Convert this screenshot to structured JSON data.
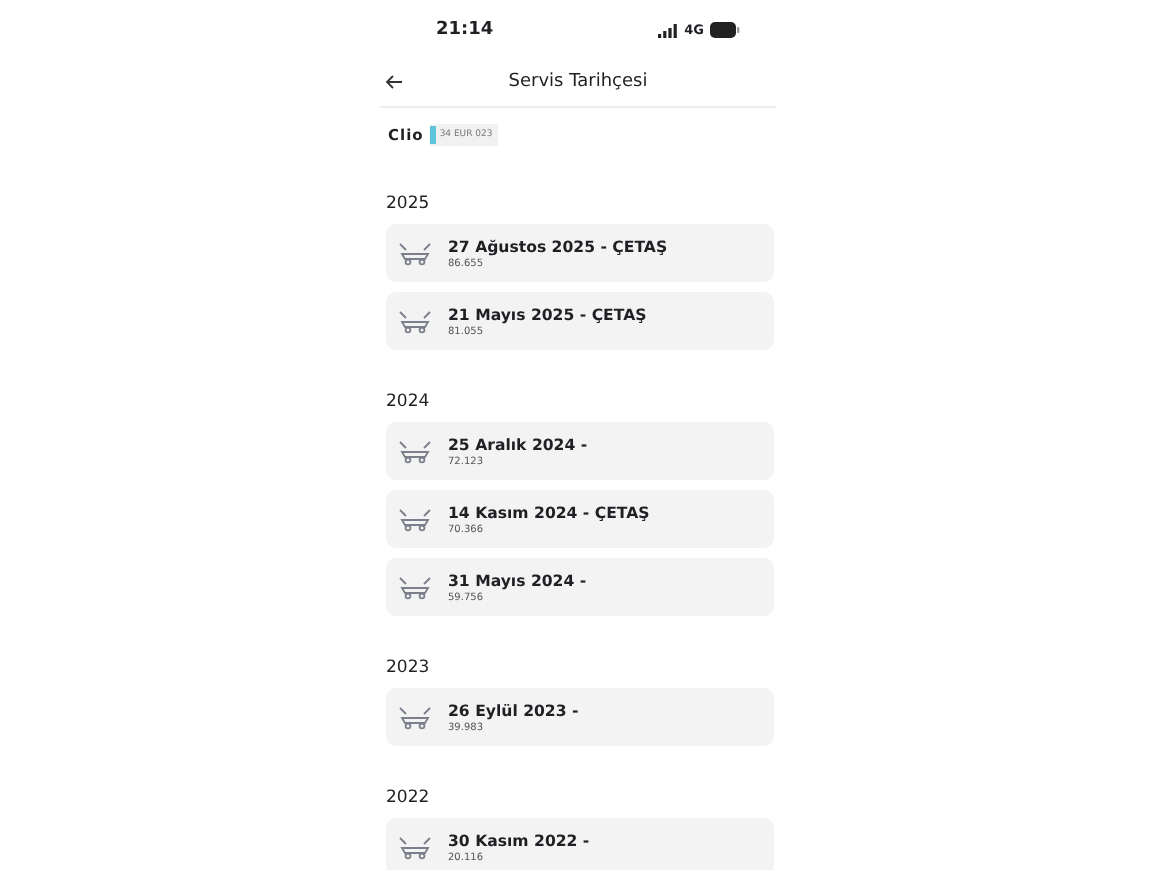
{
  "status_bar": {
    "time": "21:14",
    "network": "4G"
  },
  "header": {
    "title": "Servis Tarihçesi"
  },
  "vehicle": {
    "model": "Clio",
    "plate": "34 EUR 023"
  },
  "groups": [
    {
      "year": "2025",
      "records": [
        {
          "title": "27 Ağustos 2025 - ÇETAŞ",
          "mileage": "86.655"
        },
        {
          "title": "21 Mayıs 2025 - ÇETAŞ",
          "mileage": "81.055"
        }
      ]
    },
    {
      "year": "2024",
      "records": [
        {
          "title": "25 Aralık 2024 -",
          "mileage": "72.123"
        },
        {
          "title": "14 Kasım 2024 - ÇETAŞ",
          "mileage": "70.366"
        },
        {
          "title": "31 Mayıs 2024 -",
          "mileage": "59.756"
        }
      ]
    },
    {
      "year": "2023",
      "records": [
        {
          "title": "26 Eylül 2023 -",
          "mileage": "39.983"
        }
      ]
    },
    {
      "year": "2022",
      "records": [
        {
          "title": "30 Kasım 2022 -",
          "mileage": "20.116"
        }
      ]
    }
  ]
}
